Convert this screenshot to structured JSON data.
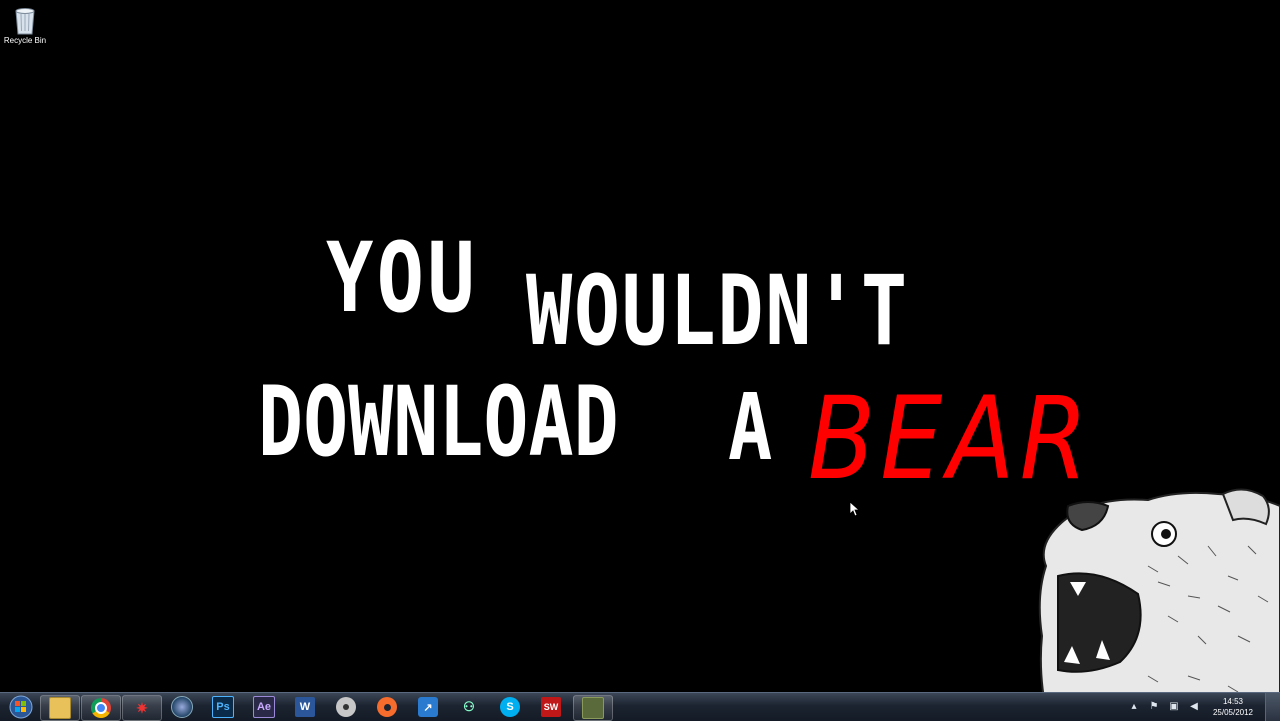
{
  "desktop": {
    "icons": [
      {
        "label": "Recycle Bin",
        "icon": "recycle-bin-icon"
      }
    ],
    "wallpaper": {
      "line1a": "YOU",
      "line1b": "WOULDN'T",
      "line2a": "DOWNLOAD",
      "line2b": "A",
      "line2c": "BEAR",
      "accent_color": "#ff0000",
      "text_color": "#ffffff",
      "image": "bear-illustration"
    }
  },
  "taskbar": {
    "start_icon": "windows-start-orb-icon",
    "items": [
      {
        "icon": "windows-explorer-icon",
        "active": true
      },
      {
        "icon": "google-chrome-icon",
        "active": true
      },
      {
        "icon": "app-red-logo-icon",
        "active": true
      },
      {
        "icon": "app-blue-globe-icon",
        "active": false
      },
      {
        "icon": "photoshop-icon",
        "label": "Ps",
        "active": false
      },
      {
        "icon": "after-effects-icon",
        "label": "Ae",
        "active": false
      },
      {
        "icon": "word-icon",
        "label": "W",
        "active": false
      },
      {
        "icon": "steam-icon",
        "active": false
      },
      {
        "icon": "origin-icon",
        "active": false
      },
      {
        "icon": "app-blue-arrow-icon",
        "active": false
      },
      {
        "icon": "network-people-icon",
        "active": false
      },
      {
        "icon": "skype-icon",
        "label": "S",
        "active": false
      },
      {
        "icon": "app-sw-icon",
        "label": "SW",
        "active": false
      },
      {
        "icon": "app-game-icon",
        "active": true
      }
    ],
    "tray_icons": [
      "show-hidden-icons-icon",
      "action-center-flag-icon",
      "network-icon",
      "volume-icon"
    ],
    "clock_time": "14:53",
    "clock_date": "25/05/2012"
  }
}
